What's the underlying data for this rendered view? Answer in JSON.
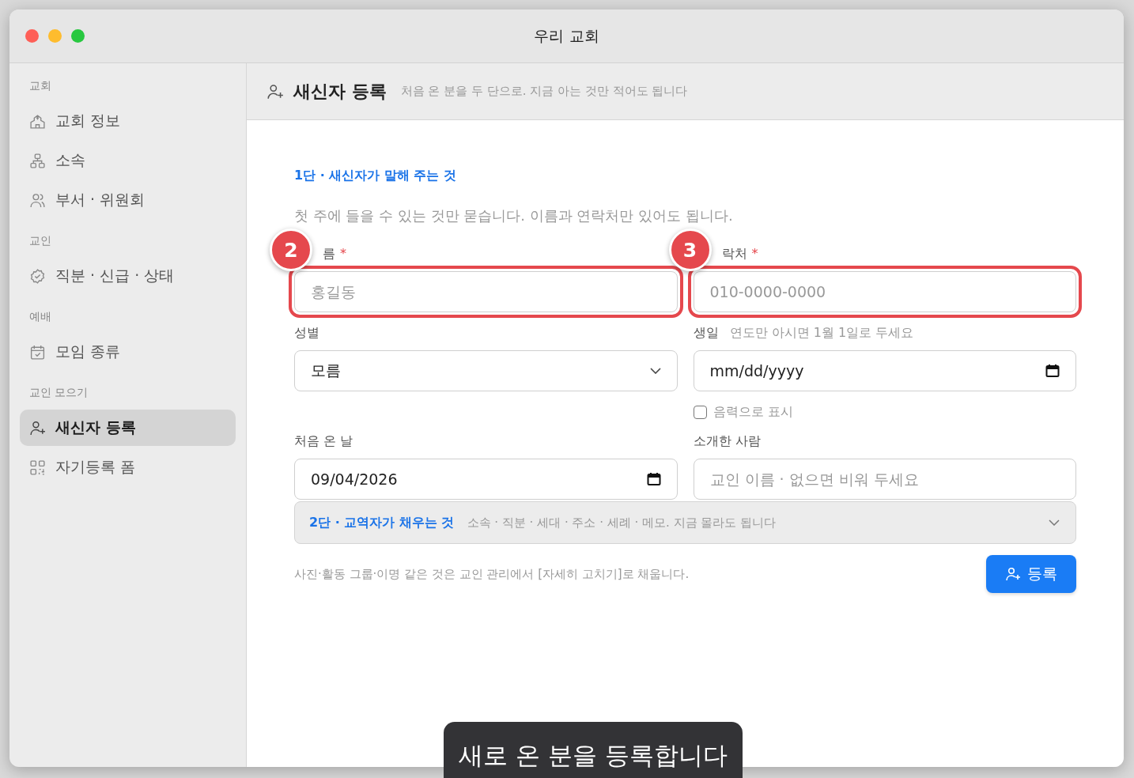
{
  "window": {
    "title": "우리 교회"
  },
  "sidebar": {
    "sections": [
      {
        "title": "교회",
        "items": [
          {
            "label": "교회 정보",
            "selected": false
          },
          {
            "label": "소속",
            "selected": false
          },
          {
            "label": "부서 · 위원회",
            "selected": false
          }
        ]
      },
      {
        "title": "교인",
        "items": [
          {
            "label": "직분 · 신급 · 상태",
            "selected": false
          }
        ]
      },
      {
        "title": "예배",
        "items": [
          {
            "label": "모임 종류",
            "selected": false
          }
        ]
      },
      {
        "title": "교인 모으기",
        "items": [
          {
            "label": "새신자 등록",
            "selected": true
          },
          {
            "label": "자기등록 폼",
            "selected": false
          }
        ]
      }
    ]
  },
  "header": {
    "title": "새신자 등록",
    "subtitle": "처음 온 분을 두 단으로. 지금 아는 것만 적어도 됩니다"
  },
  "step1": {
    "title": "1단 · 새신자가 말해 주는 것",
    "description": "첫 주에 들을 수 있는 것만 묻습니다. 이름과 연락처만 있어도 됩니다."
  },
  "fields": [
    {
      "kind": "text",
      "label": "름",
      "required_mark": "*",
      "placeholder": "홍길동",
      "badge": "2",
      "highlighted": true
    },
    {
      "kind": "text",
      "label": "락처",
      "required_mark": "*",
      "placeholder": "010-0000-0000",
      "badge": "3",
      "highlighted": true
    },
    {
      "kind": "select",
      "label": "성별",
      "value": "모름"
    },
    {
      "kind": "date",
      "label": "생일",
      "hint": "연도만 아시면 1월 1일로 두세요",
      "value": "mm/dd/yyyy",
      "checkbox": {
        "label": "음력으로 표시",
        "checked": false
      }
    },
    {
      "kind": "date",
      "label": "처음 온 날",
      "value": "09/04/2026"
    },
    {
      "kind": "text",
      "label": "소개한 사람",
      "placeholder": "교인 이름 · 없으면 비워 두세요"
    }
  ],
  "step2": {
    "title": "2단 · 교역자가 채우는 것",
    "description": "소속 · 직분 · 세대 · 주소 · 세례 · 메모. 지금 몰라도 됩니다",
    "expanded": false
  },
  "footer_note": "사진·활동 그룹·이명 같은 것은 교인 관리에서 [자세히 고치기]로 채웁니다.",
  "submit": "등록",
  "toast": "새로 온 분을 등록합니다"
}
